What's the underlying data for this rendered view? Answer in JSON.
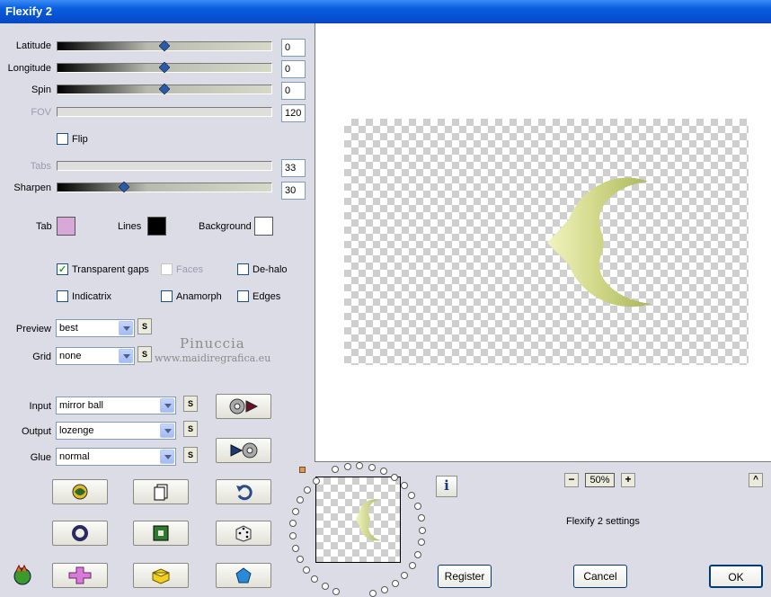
{
  "window": {
    "title": "Flexify 2"
  },
  "sliders": [
    {
      "label": "Latitude",
      "value": "0",
      "position": 0.5,
      "enabled": true
    },
    {
      "label": "Longitude",
      "value": "0",
      "position": 0.5,
      "enabled": true
    },
    {
      "label": "Spin",
      "value": "0",
      "position": 0.5,
      "enabled": true
    },
    {
      "label": "FOV",
      "value": "120",
      "enabled": false
    },
    {
      "label": "Tabs",
      "value": "33",
      "enabled": false
    },
    {
      "label": "Sharpen",
      "value": "30",
      "position": 0.3,
      "enabled": true
    }
  ],
  "flip": {
    "label": "Flip",
    "checked": false
  },
  "colors": {
    "tab": {
      "label": "Tab",
      "color": "#d8a8d8"
    },
    "lines": {
      "label": "Lines",
      "color": "#000000"
    },
    "background": {
      "label": "Background",
      "color": "#ffffff"
    }
  },
  "checkboxes": {
    "transparent_gaps": {
      "label": "Transparent gaps",
      "checked": true
    },
    "faces": {
      "label": "Faces",
      "checked": false,
      "enabled": false
    },
    "dehalo": {
      "label": "De-halo",
      "checked": false
    },
    "indicatrix": {
      "label": "Indicatrix",
      "checked": false
    },
    "anamorph": {
      "label": "Anamorph",
      "checked": false
    },
    "edges": {
      "label": "Edges",
      "checked": false
    }
  },
  "dropdowns": {
    "preview": {
      "label": "Preview",
      "value": "best"
    },
    "grid": {
      "label": "Grid",
      "value": "none"
    },
    "input": {
      "label": "Input",
      "value": "mirror ball"
    },
    "output": {
      "label": "Output",
      "value": "lozenge"
    },
    "glue": {
      "label": "Glue",
      "value": "normal"
    }
  },
  "s_button_label": "S",
  "watermark": {
    "name": "Pinuccia",
    "url": "www.maidiregrafica.eu"
  },
  "zoom": {
    "minus": "−",
    "value": "50%",
    "plus": "+"
  },
  "info_label": "i",
  "collapse_label": "^",
  "settings_label": "Flexify 2 settings",
  "buttons": {
    "register": "Register",
    "cancel": "Cancel",
    "ok": "OK"
  },
  "icons": [
    "convert-forward-icon",
    "convert-back-icon",
    "randomize-icon",
    "copy-icon",
    "undo-icon",
    "ring-icon",
    "frame-icon",
    "dice-icon",
    "plugin-logo-icon",
    "cross-shape-icon",
    "cube-icon",
    "pentagon-icon"
  ]
}
